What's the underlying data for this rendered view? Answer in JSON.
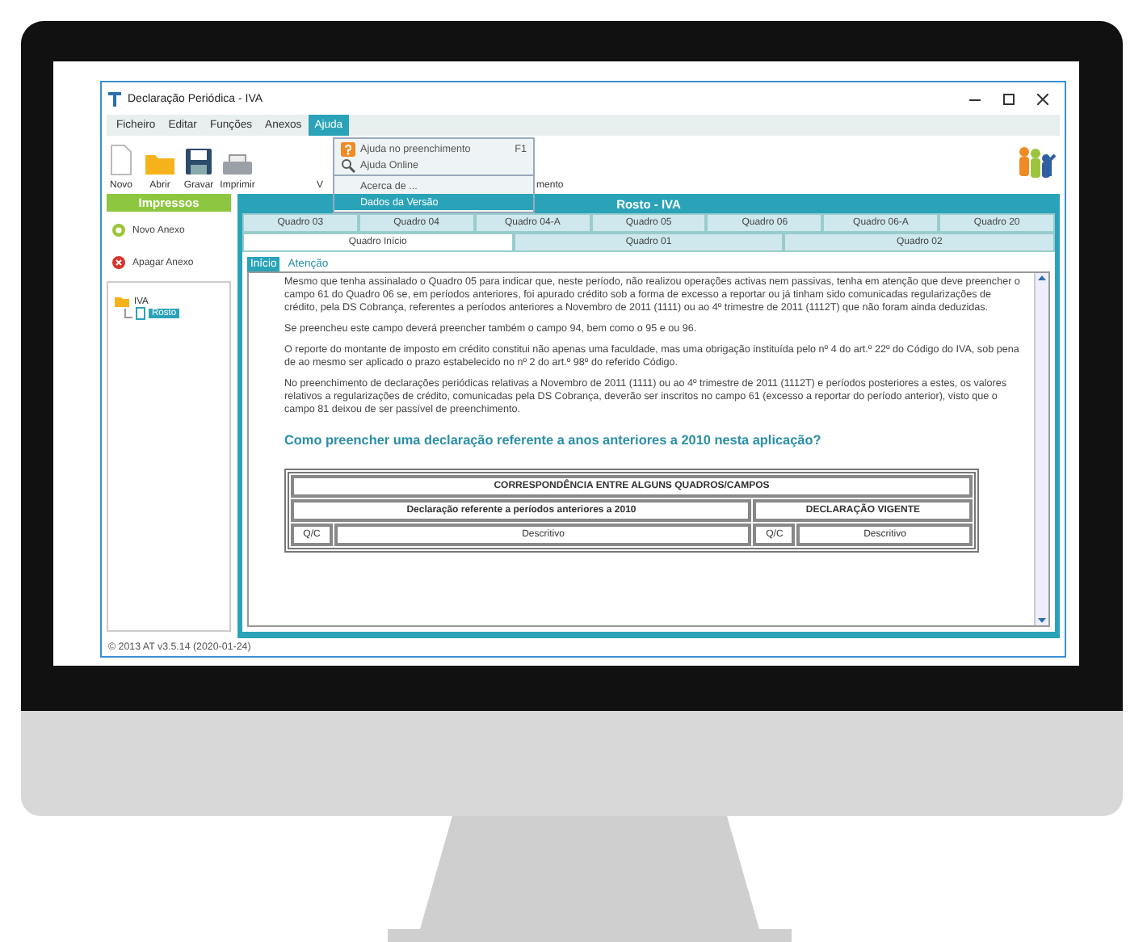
{
  "window": {
    "title": "Declaração Periódica - IVA"
  },
  "menu": [
    {
      "label": "Ficheiro",
      "selected": false
    },
    {
      "label": "Editar",
      "selected": false
    },
    {
      "label": "Funções",
      "selected": false
    },
    {
      "label": "Anexos",
      "selected": false
    },
    {
      "label": "Ajuda",
      "selected": true
    }
  ],
  "dropdown": [
    {
      "kind": "help",
      "label": "Ajuda no preenchimento",
      "shortcut": "F1",
      "selected": false
    },
    {
      "kind": "online",
      "label": "Ajuda Online",
      "selected": false
    },
    {
      "kind": "separator"
    },
    {
      "kind": "plain",
      "label": "Acerca de ...",
      "selected": false
    },
    {
      "kind": "plain",
      "label": "Dados da Versão",
      "selected": true
    }
  ],
  "toolbar": [
    {
      "kind": "new",
      "label": "Novo"
    },
    {
      "kind": "open",
      "label": "Abrir"
    },
    {
      "kind": "save",
      "label": "Gravar"
    },
    {
      "kind": "print",
      "label": "Imprimir"
    },
    {
      "kind": "partial",
      "label": "V"
    },
    {
      "kind": "partial",
      "label": "mento"
    }
  ],
  "sidebar": {
    "header": "Impressos",
    "buttons": [
      {
        "kind": "add",
        "label": "Novo Anexo"
      },
      {
        "kind": "delete",
        "label": "Apagar Anexo"
      }
    ],
    "tree": [
      {
        "label": "IVA",
        "expanded": true,
        "selected": false,
        "children": [
          {
            "label": "Rosto",
            "selected": true
          }
        ]
      }
    ]
  },
  "panel": {
    "title": "Rosto - IVA",
    "tabs_top": [
      {
        "label": "Quadro 03",
        "selected": false
      },
      {
        "label": "Quadro 04",
        "selected": false
      },
      {
        "label": "Quadro 04-A",
        "selected": false
      },
      {
        "label": "Quadro 05",
        "selected": false
      },
      {
        "label": "Quadro 06",
        "selected": false
      },
      {
        "label": "Quadro 06-A",
        "selected": false
      },
      {
        "label": "Quadro 20",
        "selected": false
      }
    ],
    "tabs_bottom": [
      {
        "label": "Quadro Início",
        "selected": true
      },
      {
        "label": "Quadro 01",
        "selected": false
      },
      {
        "label": "Quadro 02",
        "selected": false
      }
    ],
    "inner_tabs": [
      {
        "label": "Início",
        "selected": true
      },
      {
        "label": "Atenção",
        "selected": false
      }
    ],
    "paragraphs": [
      "Mesmo que tenha assinalado o Quadro 05 para indicar que, neste período, não realizou operações activas nem passivas, tenha em atenção que deve preencher o campo 61 do Quadro 06 se, em períodos anteriores, foi apurado crédito sob a forma de excesso a reportar ou já tinham sido comunicadas regularizações de crédito, pela DS Cobrança, referentes a períodos anteriores a Novembro de 2011 (1111) ou ao 4º trimestre de 2011 (1112T) que não foram ainda deduzidas.",
      "Se preencheu este campo deverá preencher também o campo 94, bem como o 95 e ou 96.",
      "O reporte do montante de imposto em crédito constitui não apenas uma faculdade, mas uma obrigação instituída pelo nº 4 do art.º 22º do Código do IVA, sob pena de ao mesmo ser aplicado o prazo estabelecido no nº 2 do art.º 98º do referido Código.",
      "No preenchimento de declarações periódicas relativas a Novembro de 2011 (1111) ou ao 4º trimestre de 2011 (1112T) e períodos posteriores a estes, os valores relativos a regularizações de crédito, comunicadas pela DS Cobrança, deverão ser inscritos no campo 61 (excesso a reportar do período anterior), visto que o campo 81 deixou de ser passível de preenchimento."
    ],
    "heading": "Como preencher uma declaração referente a anos anteriores a 2010 nesta aplicação?",
    "table": {
      "title": "CORRESPONDÊNCIA ENTRE ALGUNS QUADROS/CAMPOS",
      "groups": [
        "Declaração referente a períodos anteriores a 2010",
        "DECLARAÇÃO VIGENTE"
      ],
      "columns": [
        "Q/C",
        "Descritivo",
        "Q/C",
        "Descritivo"
      ]
    }
  },
  "status_bar": "© 2013 AT v3.5.14 (2020-01-24)"
}
